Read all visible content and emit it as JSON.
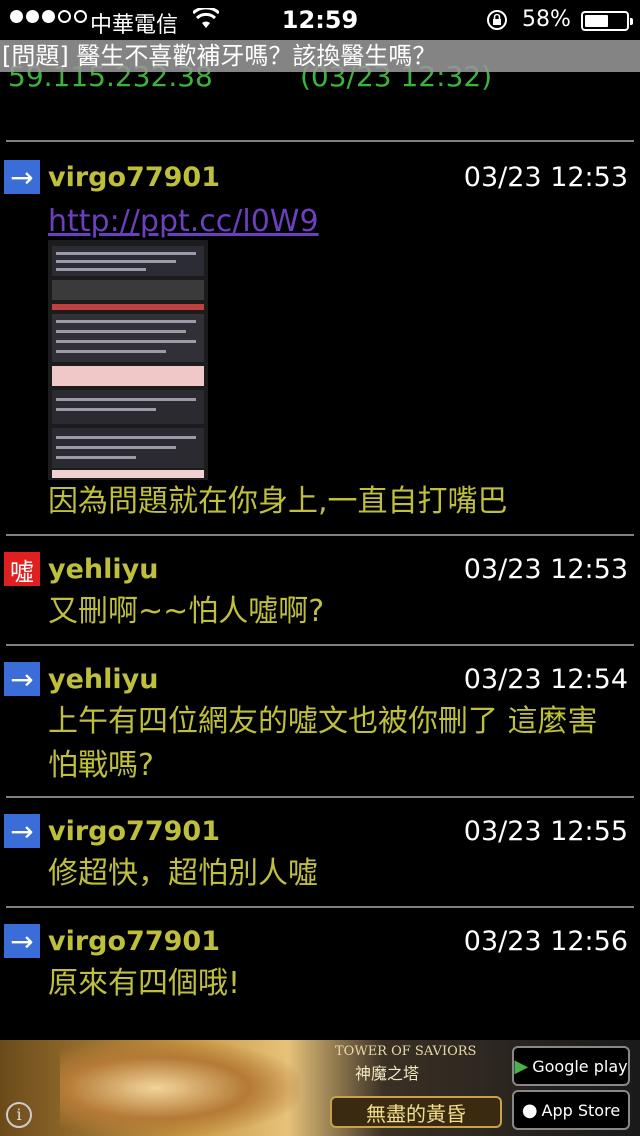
{
  "status_bar": {
    "carrier": "中華電信",
    "time": "12:59",
    "battery_percent": "58%",
    "battery_level": 0.58,
    "signal_bars_filled": 3,
    "signal_bars_total": 5
  },
  "article": {
    "title": "[問題] 醫生不喜歡補牙嗎？該換醫生嗎？",
    "partial_ip": "59.115.232.38",
    "partial_time": "(03/23 12:32)"
  },
  "pushes": [
    {
      "tag": "→",
      "user": "virgo77901",
      "time": "03/23 12:53",
      "link": "http://ppt.cc/l0W9",
      "has_image": true,
      "message": "因為問題就在你身上,一直自打嘴巴"
    },
    {
      "tag": "噓",
      "user": "yehliyu",
      "time": "03/23 12:53",
      "message": "又刪啊~~怕人噓啊?"
    },
    {
      "tag": "→",
      "user": "yehliyu",
      "time": "03/23 12:54",
      "message": "上午有四位網友的噓文也被你刪了 這麼害怕戰嗎?"
    },
    {
      "tag": "→",
      "user": "virgo77901",
      "time": "03/23 12:55",
      "message": "修超快，超怕別人噓"
    },
    {
      "tag": "→",
      "user": "virgo77901",
      "time": "03/23 12:56",
      "message": "原來有四個哦!"
    }
  ],
  "ad": {
    "game_title": "TOWER OF SAVIORS",
    "game_title_cn": "神魔之塔",
    "cta": "無盡的黃昏",
    "google_play": "Google play",
    "app_store": "App Store"
  },
  "colors": {
    "arrow_tag": "#3a6dd8",
    "boo_tag": "#e02020",
    "user_text": "#bfbf3c",
    "link": "#6c3fbf"
  }
}
